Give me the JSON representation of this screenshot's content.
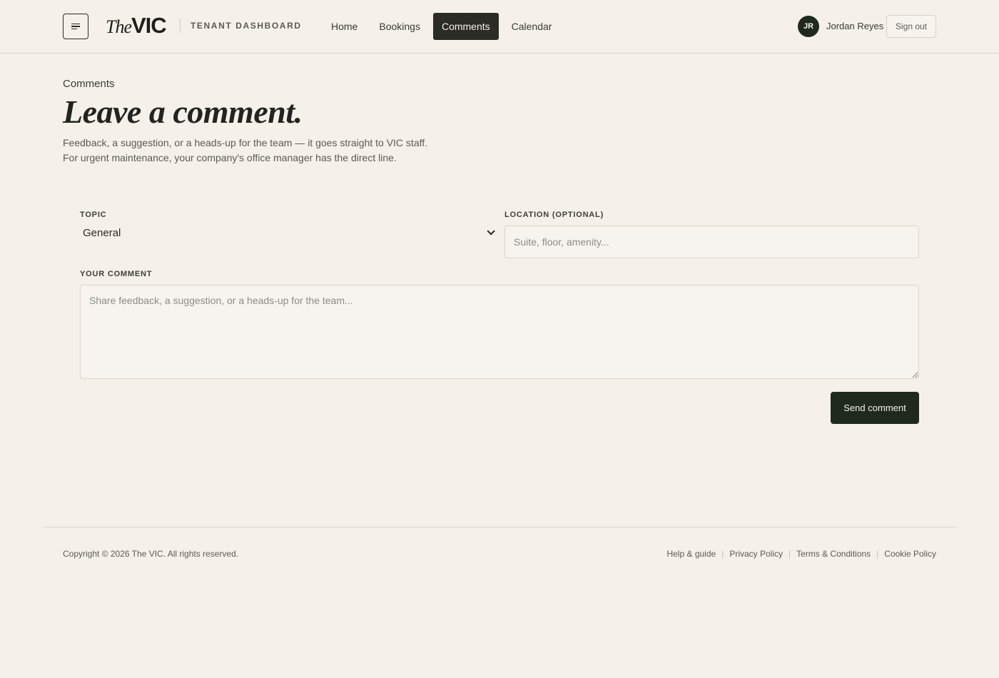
{
  "header": {
    "logo_the": "The",
    "logo_vic": "VIC",
    "dashboard_label": "TENANT DASHBOARD",
    "nav": [
      {
        "label": "Home"
      },
      {
        "label": "Bookings"
      },
      {
        "label": "Comments"
      },
      {
        "label": "Calendar"
      }
    ],
    "active_nav": "Comments",
    "user": {
      "initials": "JR",
      "name": "Jordan Reyes"
    },
    "signout_label": "Sign out"
  },
  "page": {
    "breadcrumb": "Comments",
    "title": "Leave a comment.",
    "description": "Feedback, a suggestion, or a heads-up for the team — it goes straight to VIC staff. For urgent maintenance, your company's office manager has the direct line."
  },
  "form": {
    "topic_label": "TOPIC",
    "topic_value": "General",
    "location_label": "LOCATION (OPTIONAL)",
    "location_placeholder": "Suite, floor, amenity...",
    "location_value": "",
    "comment_label": "YOUR COMMENT",
    "comment_placeholder": "Share feedback, a suggestion, or a heads-up for the team...",
    "comment_value": "",
    "submit_label": "Send comment"
  },
  "footer": {
    "copyright": "Copyright © 2026 The VIC. All rights reserved.",
    "links": [
      {
        "label": "Help & guide"
      },
      {
        "label": "Privacy Policy"
      },
      {
        "label": "Terms & Conditions"
      },
      {
        "label": "Cookie Policy"
      }
    ]
  },
  "colors": {
    "background": "#f5f0ea",
    "accent_dark": "#1f2a1c",
    "nav_active": "#2a2c25"
  },
  "icons": {
    "menu": "hamburger-menu-icon",
    "topic_dropdown": "chevron-down-icon"
  }
}
